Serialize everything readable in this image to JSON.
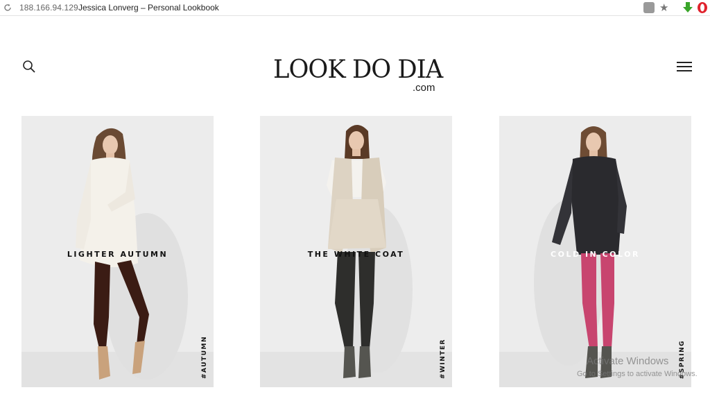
{
  "browser": {
    "address": "188.166.94.129",
    "page_title": "Jessica Lonverg – Personal Lookbook",
    "icons": [
      "reload-icon",
      "page-action-icon",
      "star-icon",
      "download-extension-icon",
      "opera-icon"
    ]
  },
  "header": {
    "logo_main": "LOOK DO DIA",
    "logo_sub": ".com",
    "icons": [
      "search-icon",
      "hamburger-menu-icon"
    ]
  },
  "cards": [
    {
      "caption": "LIGHTER AUTUMN",
      "tag": "#AUTUMN"
    },
    {
      "caption": "THE WHITE COAT",
      "tag": "#WINTER"
    },
    {
      "caption": "COLD IN COLOR",
      "tag": "#SPRING"
    }
  ],
  "watermark": {
    "line1": "Activate Windows",
    "line2": "Go to Settings to activate Windows."
  },
  "colors": {
    "text": "#111111",
    "card_bg": "#ececec",
    "tights_1": "#3b1c14",
    "tights_2": "#2e2e2c",
    "tights_3": "#c8456f"
  }
}
